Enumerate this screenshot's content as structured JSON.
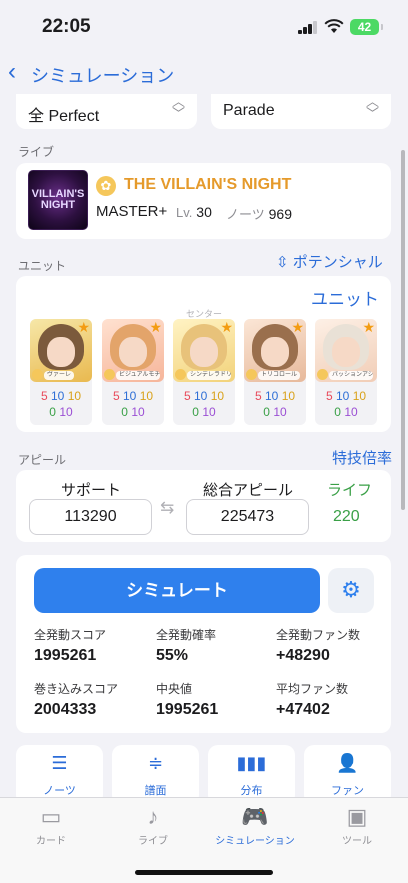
{
  "status_bar": {
    "time": "22:05",
    "battery": "42"
  },
  "nav": {
    "back_icon": "chevron-left-icon",
    "title": "シミュレーション"
  },
  "selectors": [
    {
      "value": "全 Perfect"
    },
    {
      "value": "Parade"
    }
  ],
  "live": {
    "section_label": "ライブ",
    "jacket_text": "VILLAIN'S NIGHT",
    "title": "THE VILLAIN'S NIGHT",
    "difficulty": "MASTER+",
    "level_label": "Lv.",
    "level": "30",
    "notes_label": "ノーツ",
    "notes": "969"
  },
  "unit": {
    "section_label": "ユニット",
    "potential_label": "ポテンシャル",
    "unit_link": "ユニット",
    "center_label": "センター",
    "members": [
      {
        "tag": "ヴァーレ",
        "row1": [
          "5",
          "10",
          "10"
        ],
        "row2": [
          "0",
          "10"
        ],
        "hair": "#7b5a3c"
      },
      {
        "tag": "ビジュアルモチーフ",
        "row1": [
          "5",
          "10",
          "10"
        ],
        "row2": [
          "0",
          "10"
        ],
        "hair": "#e3a46a"
      },
      {
        "tag": "シンデレラドリーム",
        "row1": [
          "5",
          "10",
          "10"
        ],
        "row2": [
          "0",
          "10"
        ],
        "hair": "#e8c27a"
      },
      {
        "tag": "トリコロール",
        "row1": [
          "5",
          "10",
          "10"
        ],
        "row2": [
          "0",
          "10"
        ],
        "hair": "#9a6f4d"
      },
      {
        "tag": "パッションアシスト",
        "row1": [
          "5",
          "10",
          "10"
        ],
        "row2": [
          "0",
          "10"
        ],
        "hair": "#e9e1d6"
      }
    ]
  },
  "appeal": {
    "section_label": "アピール",
    "tokugi_label": "特技倍率",
    "support_label": "サポート",
    "support_value": "113290",
    "total_label": "総合アピール",
    "total_value": "225473",
    "life_label": "ライフ",
    "life_value": "220"
  },
  "simulation": {
    "button_label": "シミュレート",
    "stats": [
      {
        "label": "全発動スコア",
        "value": "1995261"
      },
      {
        "label": "全発動確率",
        "value": "55%"
      },
      {
        "label": "全発動ファン数",
        "value": "+48290"
      },
      {
        "label": "巻き込みスコア",
        "value": "2004333"
      },
      {
        "label": "中央値",
        "value": "1995261"
      },
      {
        "label": "平均ファン数",
        "value": "+47402"
      }
    ]
  },
  "tools": [
    {
      "label": "ノーツ"
    },
    {
      "label": "譜面"
    },
    {
      "label": "分布"
    },
    {
      "label": "ファン"
    }
  ],
  "tabbar": [
    {
      "label": "カード",
      "active": false
    },
    {
      "label": "ライブ",
      "active": false
    },
    {
      "label": "シミュレーション",
      "active": true
    },
    {
      "label": "ツール",
      "active": false
    }
  ],
  "colors": {
    "accent": "#2b6cd8",
    "button": "#2f80ed",
    "life": "#3aa047",
    "live_title": "#e59a2b"
  }
}
